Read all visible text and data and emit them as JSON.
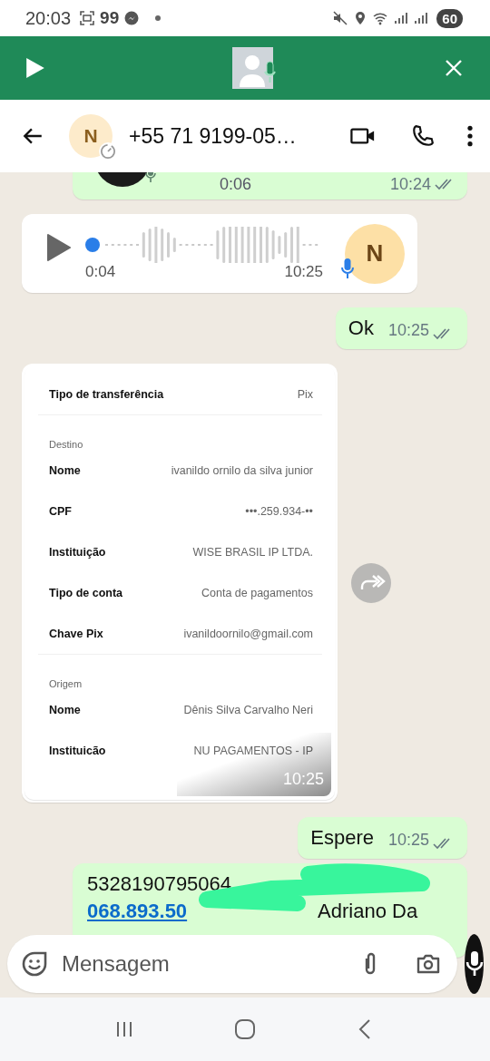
{
  "status_bar": {
    "time": "20:03",
    "notification_count": "99",
    "battery": "60"
  },
  "header": {
    "avatar_letter": "N",
    "contact": "+55 71 9199-05…"
  },
  "messages": [
    {
      "kind": "voice",
      "outgoing": true,
      "duration": "0:06",
      "time": "10:24",
      "read": true
    },
    {
      "kind": "voice",
      "outgoing": false,
      "avatar_letter": "N",
      "duration": "0:04",
      "time": "10:25"
    },
    {
      "kind": "text",
      "outgoing": true,
      "text": "Ok",
      "time": "10:25",
      "read": true
    },
    {
      "outgoing": false,
      "time": "10:25",
      "receipt": [
        {
          "kind": "row",
          "label": "Tipo de transferência",
          "value": "Pix"
        },
        {
          "kind": "divider"
        },
        {
          "kind": "section",
          "label": "Destino"
        },
        {
          "kind": "row",
          "label": "Nome",
          "value": "ivanildo ornilo da silva junior"
        },
        {
          "kind": "row",
          "label": "CPF",
          "value": "•••.259.934-••"
        },
        {
          "kind": "row",
          "label": "Instituição",
          "value": "WISE BRASIL IP LTDA."
        },
        {
          "kind": "row",
          "label": "Tipo de conta",
          "value": "Conta de pagamentos"
        },
        {
          "kind": "row",
          "label": "Chave Pix",
          "value": "ivanildoornilo@gmail.com"
        },
        {
          "kind": "divider"
        },
        {
          "kind": "section",
          "label": "Origem"
        },
        {
          "kind": "row",
          "label": "Nome",
          "value": "Dênis Silva Carvalho Neri"
        },
        {
          "kind": "row",
          "label": "Instituicão",
          "value": "NU PAGAMENTOS - IP"
        }
      ]
    },
    {
      "kind": "text",
      "outgoing": true,
      "text": "Espere",
      "time": "10:25",
      "read": true
    },
    {
      "kind": "covered",
      "outgoing": true,
      "first_line": "5328190795064",
      "link": "068.893.50",
      "rest": "Adriano Da"
    }
  ],
  "composer": {
    "placeholder": "Mensagem"
  }
}
